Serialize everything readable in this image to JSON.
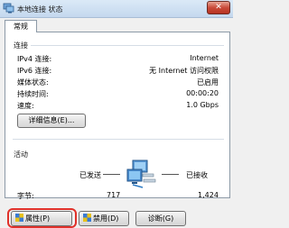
{
  "window": {
    "title": "本地连接 状态",
    "close_label": "✕"
  },
  "tabs": [
    {
      "label": "常规"
    }
  ],
  "connection": {
    "heading": "连接",
    "rows": [
      {
        "label": "IPv4 连接:",
        "value": "Internet"
      },
      {
        "label": "IPv6 连接:",
        "value": "无 Internet 访问权限"
      },
      {
        "label": "媒体状态:",
        "value": "已启用"
      },
      {
        "label": "持续时间:",
        "value": "00:00:20"
      },
      {
        "label": "速度:",
        "value": "1.0 Gbps"
      }
    ],
    "details_button": "详细信息(E)..."
  },
  "activity": {
    "heading": "活动",
    "sent_label": "已发送",
    "received_label": "已接收",
    "bytes_label": "字节:",
    "sent_bytes": "717",
    "received_bytes": "1,424"
  },
  "buttons": {
    "properties": "属性(P)",
    "disable": "禁用(D)",
    "diagnose": "诊断(G)"
  },
  "colors": {
    "highlight": "#e0312a",
    "title_bar": "#c4d8ee"
  }
}
